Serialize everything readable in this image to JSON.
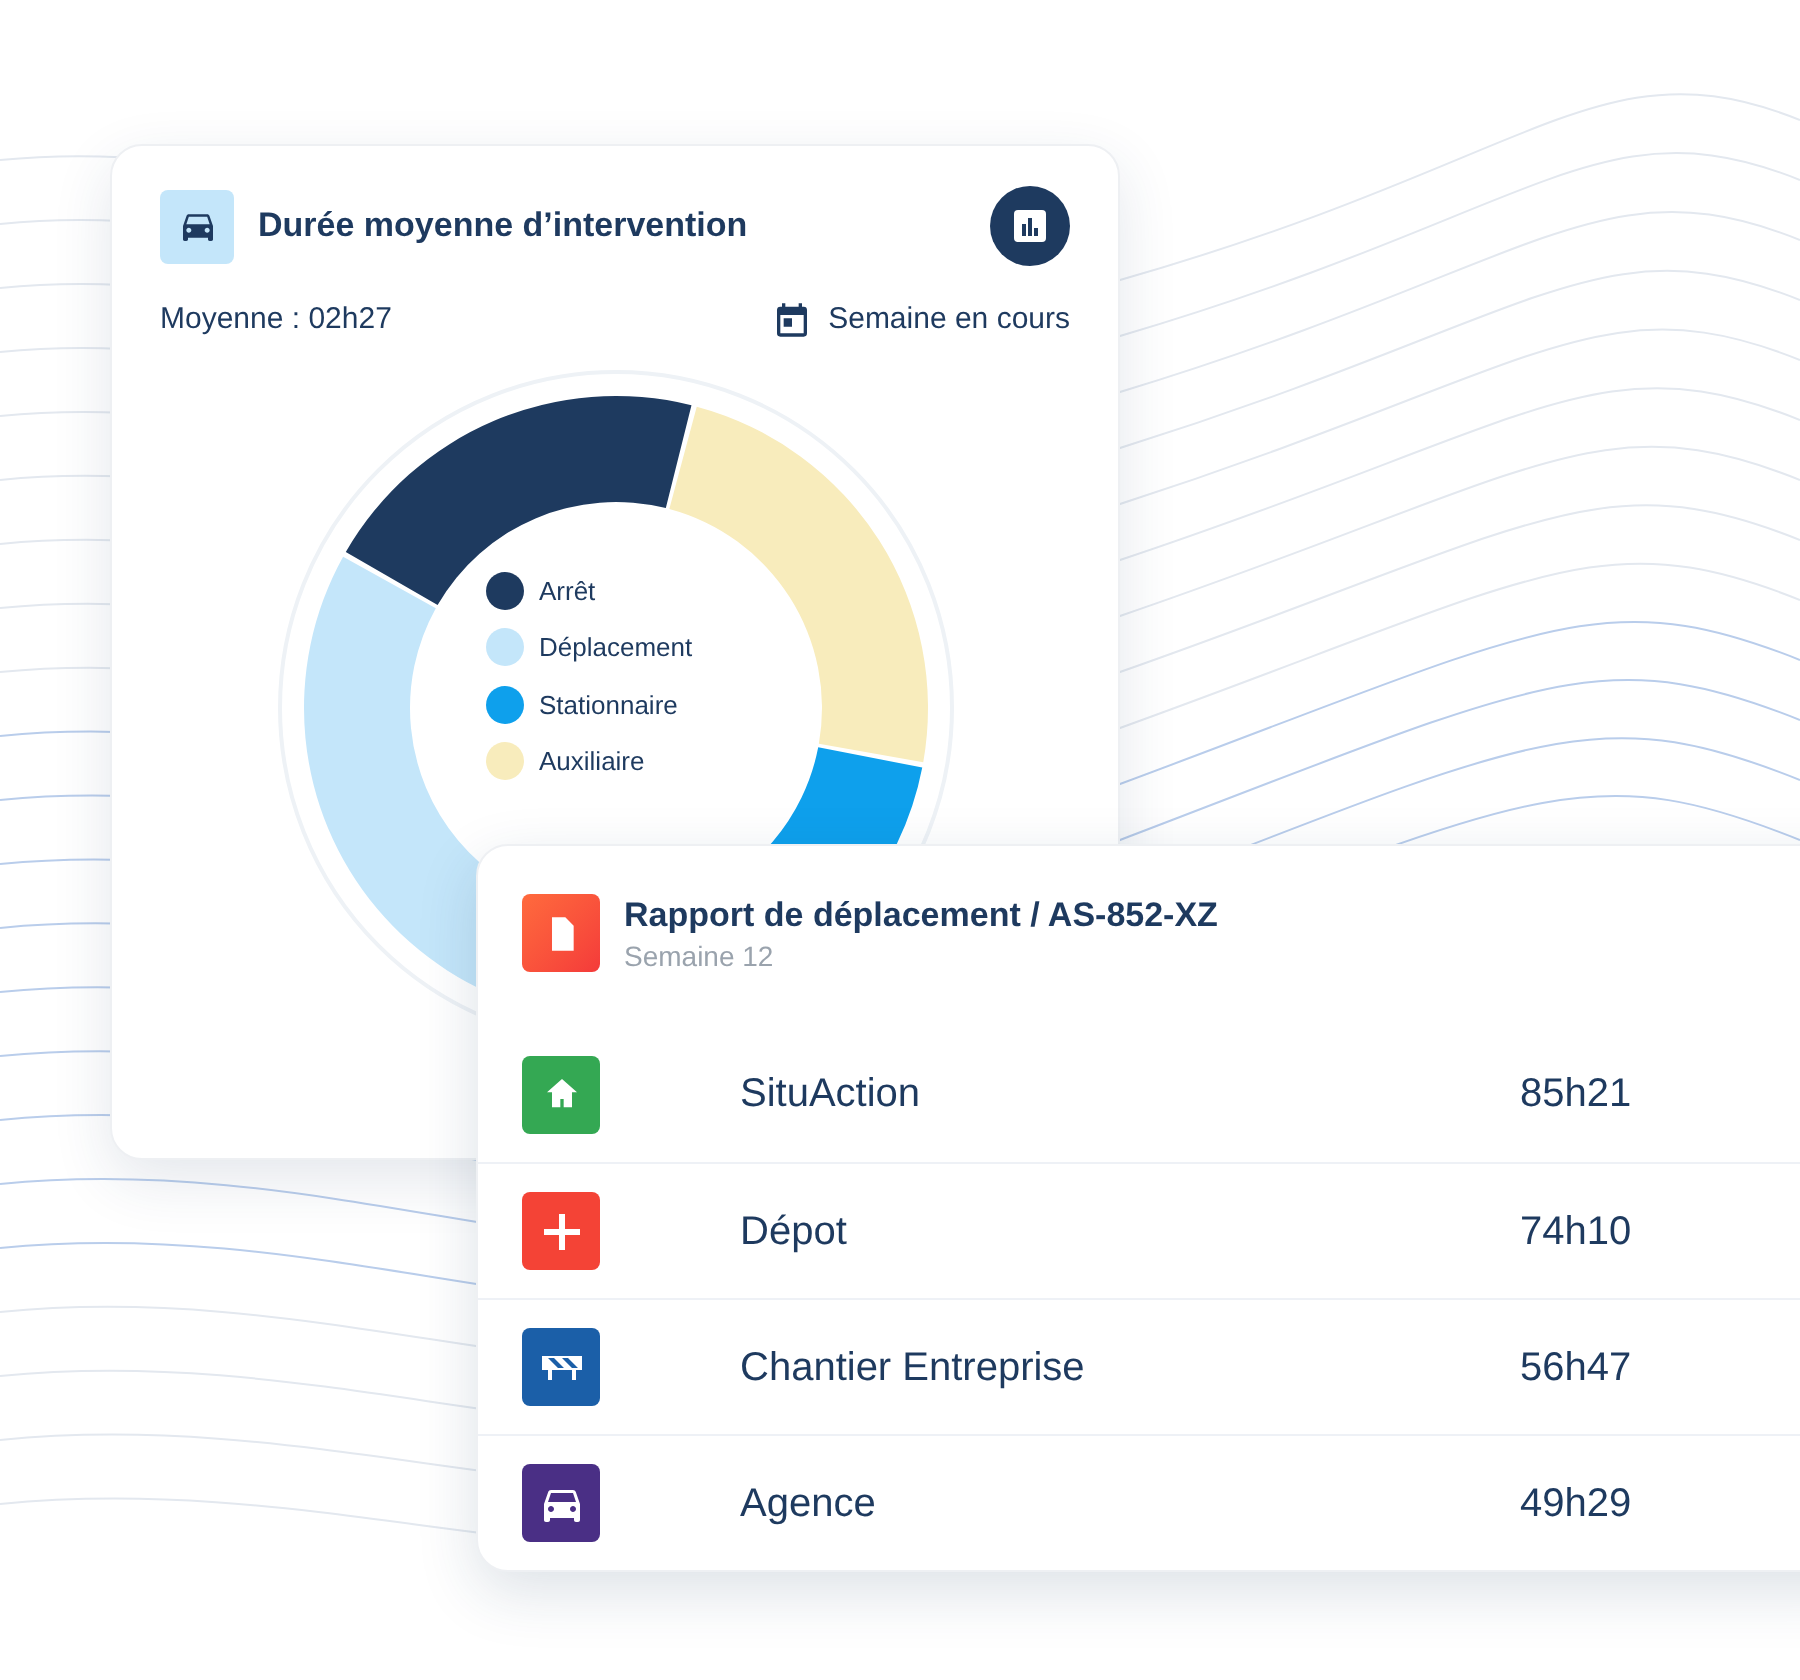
{
  "duration_card": {
    "title": "Durée moyenne d’intervention",
    "average": "Moyenne : 02h27",
    "period": "Semaine en cours",
    "legend": [
      {
        "label": "Arrêt",
        "color": "#1e3a5f"
      },
      {
        "label": "Déplacement",
        "color": "#c4e6fa"
      },
      {
        "label": "Stationnaire",
        "color": "#0ea0ec"
      },
      {
        "label": "Auxiliaire",
        "color": "#f8ecbc"
      }
    ]
  },
  "report_card": {
    "title": "Rapport de déplacement / AS-852-XZ",
    "subtitle": "Semaine 12",
    "rows": [
      {
        "kind": "home",
        "name": "SituAction",
        "value": "85h21",
        "color": "#34a853"
      },
      {
        "kind": "plus",
        "name": "Dépot",
        "value": "74h10",
        "color": "#f44336"
      },
      {
        "kind": "barrier",
        "name": "Chantier Entreprise",
        "value": "56h47",
        "color": "#1b5fa8"
      },
      {
        "kind": "car",
        "name": "Agence",
        "value": "49h29",
        "color": "#4a2f85"
      }
    ]
  }
}
